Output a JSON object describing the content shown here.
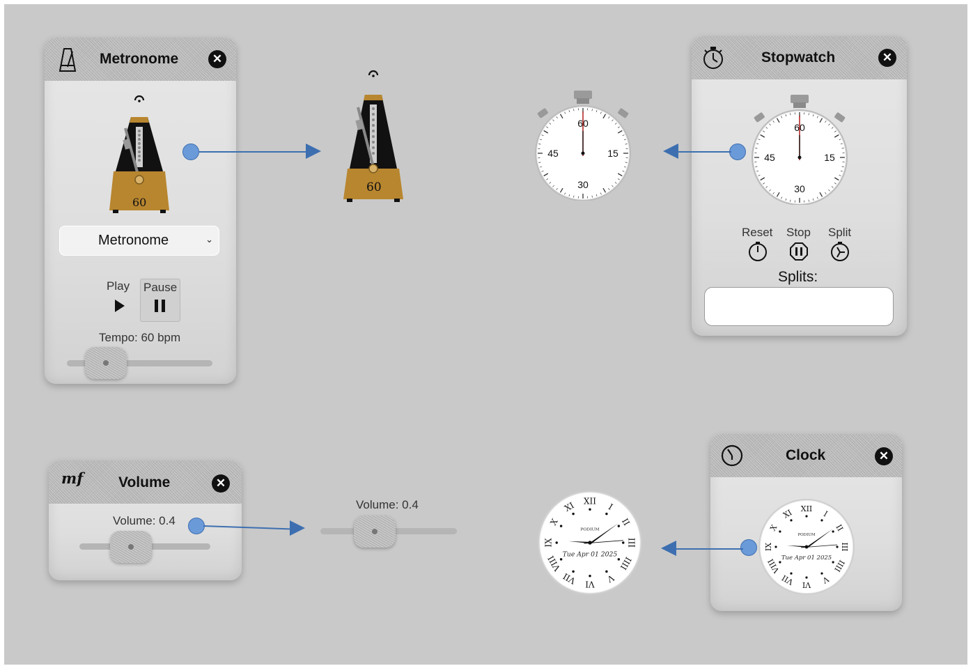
{
  "metronome": {
    "title": "Metronome",
    "close_glyph": "✕",
    "dial_value": "60",
    "preset_value": "Metronome",
    "play_label": "Play",
    "pause_label": "Pause",
    "tempo_label": "Tempo: 60 bpm",
    "tempo_level": 0.27
  },
  "metronome_preview": {
    "dial_value": "60"
  },
  "stopwatch": {
    "title": "Stopwatch",
    "close_glyph": "✕",
    "dial_labels": [
      "60",
      "15",
      "30",
      "45"
    ],
    "reset_label": "Reset",
    "stop_label": "Stop",
    "split_label": "Split",
    "splits_label": "Splits:",
    "splits_value": ""
  },
  "stopwatch_preview": {
    "dial_labels": [
      "60",
      "15",
      "30",
      "45"
    ]
  },
  "volume": {
    "title": "Volume",
    "badge": "mf",
    "close_glyph": "✕",
    "label": "Volume: 0.4",
    "level": 0.4
  },
  "volume_preview": {
    "label": "Volume: 0.4",
    "level": 0.4
  },
  "clock": {
    "title": "Clock",
    "close_glyph": "✕",
    "brand": "PODIUM",
    "date": "Tue Apr 01 2025",
    "numerals": [
      "XII",
      "I",
      "II",
      "III",
      "IIII",
      "V",
      "VI",
      "VII",
      "VIII",
      "IX",
      "X",
      "XI"
    ]
  },
  "clock_preview": {
    "brand": "PODIUM",
    "date": "Tue Apr 01 2025",
    "numerals": [
      "XII",
      "I",
      "II",
      "III",
      "IIII",
      "V",
      "VI",
      "VII",
      "VIII",
      "IX",
      "X",
      "XI"
    ]
  },
  "colors": {
    "background": "#c9c9c9",
    "accent_arrow": "#3d6fb0",
    "arrow_dot": "#6b9ad9",
    "metronome_wood": "#b8862f"
  }
}
